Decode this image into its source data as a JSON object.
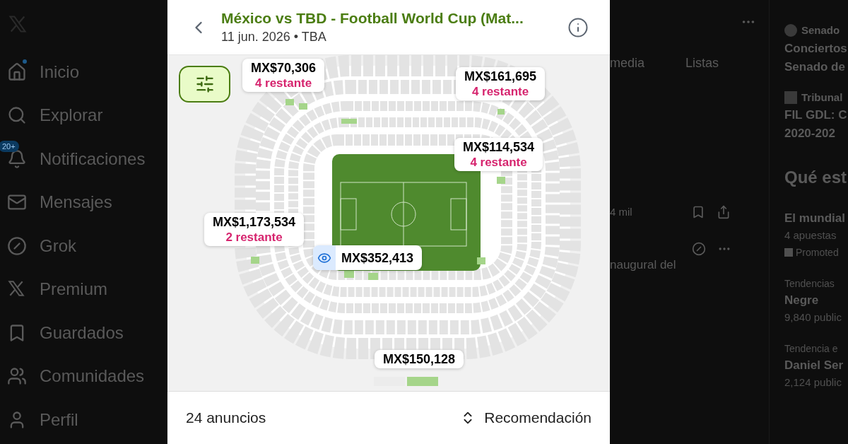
{
  "sidebar": {
    "items": [
      {
        "label": "Inicio",
        "dot": true
      },
      {
        "label": "Explorar",
        "dot": false
      },
      {
        "label": "Notificaciones",
        "dot": false,
        "badge": "20+"
      },
      {
        "label": "Mensajes",
        "dot": false
      },
      {
        "label": "Grok",
        "dot": false
      },
      {
        "label": "Premium",
        "dot": false
      },
      {
        "label": "Guardados",
        "dot": false
      },
      {
        "label": "Comunidades",
        "dot": false
      },
      {
        "label": "Perfil",
        "dot": false
      }
    ]
  },
  "timeline": {
    "tabs": [
      "media",
      "Listas"
    ],
    "post_stat": "4 mil",
    "post_text": "naugural del"
  },
  "right_column": {
    "news": [
      {
        "source": "Senado",
        "lines": [
          "Conciertos",
          "Senado de"
        ]
      },
      {
        "source": "Tribunal",
        "lines": [
          "FIL GDL: C",
          "2020-202"
        ]
      }
    ],
    "heading": "Qué est",
    "trends": [
      {
        "title": "El mundial",
        "meta": "4 apuestas",
        "promoted": "Promoted"
      },
      {
        "context": "Tendencias",
        "title": "Negre",
        "meta": "9,840 public"
      },
      {
        "context": "Tendencia e",
        "title": "Daniel Ser",
        "meta": "2,124 public"
      }
    ]
  },
  "modal": {
    "title": "México vs TBD - Football World Cup (Mat...",
    "date": "11 jun. 2026 • TBA",
    "filter": {
      "active": true
    },
    "listings": [
      {
        "kind": "tag",
        "price": "MX$70,306",
        "remaining": "4 restante"
      },
      {
        "kind": "tag",
        "price": "MX$161,695",
        "remaining": "4 restante"
      },
      {
        "kind": "tag",
        "price": "MX$114,534",
        "remaining": "4 restante"
      },
      {
        "kind": "tag",
        "price": "MX$1,173,534",
        "remaining": "2 restante"
      },
      {
        "kind": "viewed",
        "price": "MX$352,413"
      },
      {
        "kind": "tag",
        "price": "MX$150,128"
      }
    ],
    "count": "24 anuncios",
    "sort": "Recomendación"
  }
}
